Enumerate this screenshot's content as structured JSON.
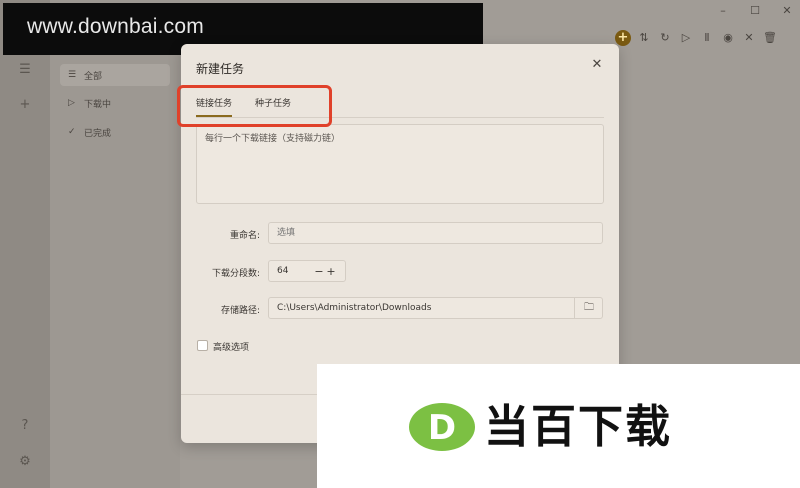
{
  "watermark": {
    "text": "www.downbai.com"
  },
  "sidebar": {
    "items": [
      {
        "icon": "list-icon",
        "label": "全部",
        "active": true
      },
      {
        "icon": "play-icon",
        "label": "下载中"
      },
      {
        "icon": "check-icon",
        "label": "已完成"
      }
    ]
  },
  "dialog": {
    "title": "新建任务",
    "tabs": [
      {
        "label": "链接任务",
        "active": true
      },
      {
        "label": "种子任务"
      }
    ],
    "links_placeholder": "每行一个下载链接（支持磁力链）",
    "rename_label": "重命名:",
    "rename_placeholder": "选填",
    "segments_label": "下载分段数:",
    "segments_value": "64",
    "path_label": "存储路径:",
    "path_value": "C:\\Users\\Administrator\\Downloads",
    "advanced_label": "高级选项"
  },
  "logo": {
    "text": "当百下载",
    "mark_letter": "D",
    "mark_color": "#7cc043"
  },
  "colors": {
    "accent": "#8a6a1e",
    "highlight": "#e0412a"
  }
}
